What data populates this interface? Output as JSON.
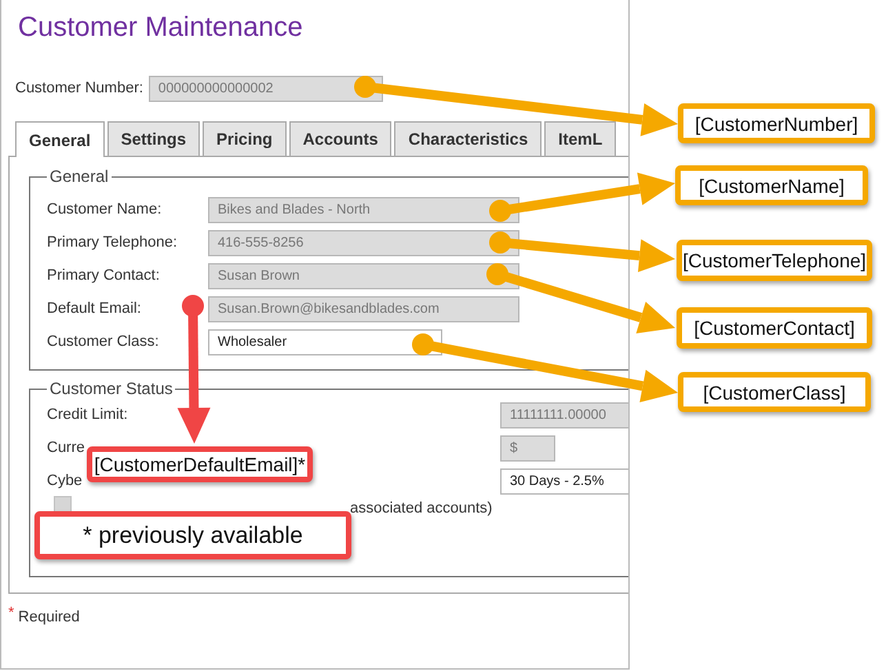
{
  "window": {
    "title": "Customer Maintenance"
  },
  "customer_number": {
    "label": "Customer Number:",
    "value": "000000000000002",
    "disabled": true
  },
  "tabs": [
    {
      "label": "General",
      "selected": true
    },
    {
      "label": "Settings",
      "selected": false
    },
    {
      "label": "Pricing",
      "selected": false
    },
    {
      "label": "Accounts",
      "selected": false
    },
    {
      "label": "Characteristics",
      "selected": false
    },
    {
      "label": "ItemL",
      "selected": false
    }
  ],
  "general_group": {
    "legend": "General",
    "fields": [
      {
        "label": "Customer Name:",
        "value": "Bikes and Blades - North",
        "disabled": true
      },
      {
        "label": "Primary Telephone:",
        "value": "416-555-8256",
        "disabled": true
      },
      {
        "label": "Primary Contact:",
        "value": "Susan Brown",
        "disabled": true
      },
      {
        "label": "Default Email:",
        "value": "Susan.Brown@bikesandblades.com",
        "disabled": true
      },
      {
        "label": "Customer Class:",
        "value": "Wholesaler",
        "disabled": false
      }
    ]
  },
  "status_group": {
    "legend": "Customer Status",
    "fields": [
      {
        "label": "Credit Limit:",
        "value": "11111111.00000",
        "disabled": true
      },
      {
        "label": "Curre",
        "value": "$",
        "disabled": true
      },
      {
        "label": "Cybe",
        "value": "30 Days - 2.5%",
        "disabled": false
      }
    ],
    "checkbox": {
      "label": "associated accounts)",
      "checked": false
    }
  },
  "required_note": {
    "mark": "*",
    "text": "Required"
  },
  "callouts": [
    {
      "text": "[CustomerNumber]",
      "kind": "current"
    },
    {
      "text": "[CustomerName]",
      "kind": "current"
    },
    {
      "text": "[CustomerTelephone]",
      "kind": "current"
    },
    {
      "text": "[CustomerContact]",
      "kind": "current"
    },
    {
      "text": "[CustomerClass]",
      "kind": "current"
    },
    {
      "text": "[CustomerDefaultEmail]*",
      "kind": "previous"
    },
    {
      "text": "* previously available",
      "kind": "footnote"
    }
  ]
}
